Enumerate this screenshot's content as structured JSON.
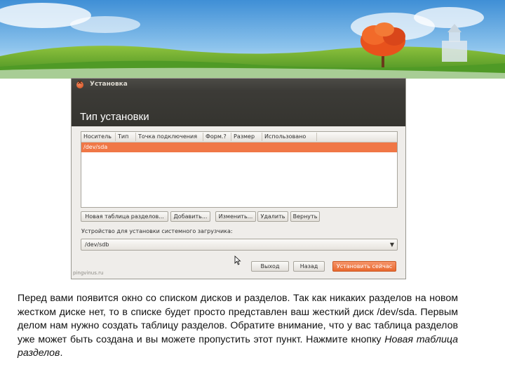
{
  "window": {
    "title": "Установка",
    "header": "Тип установки"
  },
  "table": {
    "columns": [
      "Носитель",
      "Тип",
      "Точка подключения",
      "Форм.?",
      "Размер",
      "Использовано"
    ],
    "rows": [
      {
        "device": "/dev/sda",
        "selected": true
      }
    ]
  },
  "actions": {
    "new_table": "Новая таблица разделов...",
    "add": "Добавить...",
    "change": "Изменить...",
    "delete": "Удалить",
    "revert": "Вернуть"
  },
  "bootloader": {
    "label": "Устройство для установки системного загрузчика:",
    "value": "/dev/sdb"
  },
  "footer": {
    "watermark": "pingvinus.ru",
    "quit": "Выход",
    "back": "Назад",
    "install": "Установить сейчас"
  },
  "caption": {
    "text_main": "Перед вами появится окно со списком дисков и разделов. Так как никаких разделов на новом жестком диске нет, то в списке будет просто представлен ваш жесткий диск /dev/sda. Первым делом нам нужно создать таблицу разделов. Обратите внимание, что у вас таблица разделов уже может быть создана и вы можете пропустить этот пункт. Нажмите кнопку ",
    "text_button": "Новая таблица разделов",
    "text_end": "."
  },
  "colors": {
    "accent": "#f07746",
    "titlebar": "#3c3b37",
    "window_bg": "#efedea"
  },
  "icons": [
    "close-icon",
    "dropdown-arrow-icon",
    "mouse-pointer-icon"
  ]
}
